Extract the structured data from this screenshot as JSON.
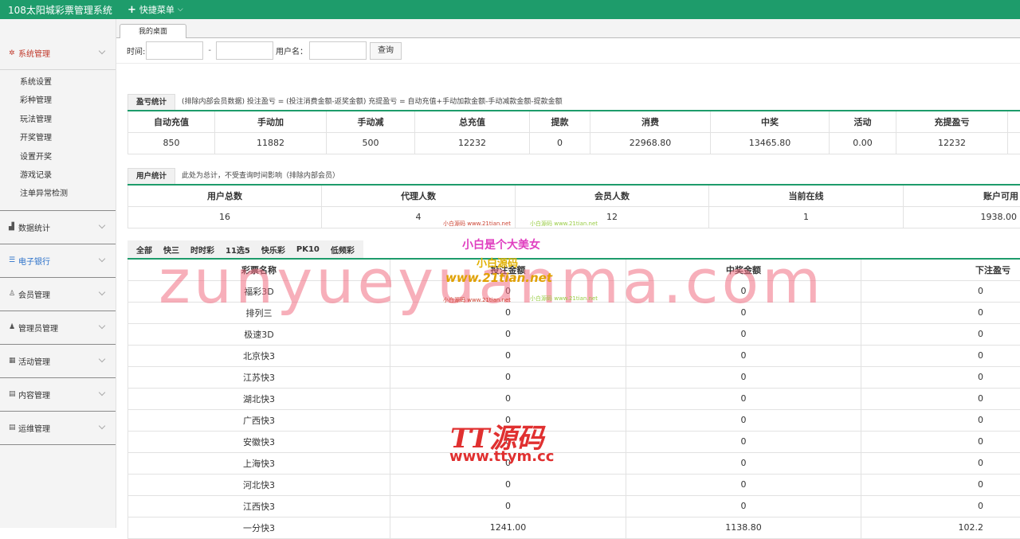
{
  "header": {
    "title": "108太阳城彩票管理系统",
    "quick_menu": "快捷菜单"
  },
  "sidebar": {
    "groups": [
      {
        "label": "系统管理",
        "icon": "gear-icon",
        "items": [
          "系统设置",
          "彩种管理",
          "玩法管理",
          "开奖管理",
          "设置开奖",
          "游戏记录",
          "注单异常检测"
        ]
      },
      {
        "label": "数据统计",
        "icon": "bar-chart-icon"
      },
      {
        "label": "电子银行",
        "icon": "list-icon"
      },
      {
        "label": "会员管理",
        "icon": "user-icon"
      },
      {
        "label": "管理员管理",
        "icon": "admin-icon"
      },
      {
        "label": "活动管理",
        "icon": "calendar-icon"
      },
      {
        "label": "内容管理",
        "icon": "content-icon"
      },
      {
        "label": "运维管理",
        "icon": "ops-icon"
      }
    ]
  },
  "tabs": {
    "desktop": "我的桌面"
  },
  "filter": {
    "time_label": "时间:",
    "dash": "-",
    "user_label": "用户名：",
    "query_button": "查询"
  },
  "profit": {
    "title": "盈亏统计",
    "note": "(排除内部会员数据)  投注盈亏 = (投注消费金额-返奖金额)    充提盈亏 = 自动充值+手动加款金额-手动减款金额-提款金额",
    "headers": [
      "自动充值",
      "手动加",
      "手动减",
      "总充值",
      "提款",
      "消费",
      "中奖",
      "活动",
      "充提盈亏"
    ],
    "values": [
      "850",
      "11882",
      "500",
      "12232",
      "0",
      "22968.80",
      "13465.80",
      "0.00",
      "12232"
    ]
  },
  "users": {
    "title": "用户统计",
    "note": "此处为总计，不受查询时间影响（排除内部会员）",
    "headers": [
      "用户总数",
      "代理人数",
      "会员人数",
      "当前在线",
      "账户可用"
    ],
    "values": [
      "16",
      "4",
      "12",
      "1",
      "1938.00"
    ]
  },
  "lottery_tabs": [
    "全部",
    "快三",
    "时时彩",
    "11选5",
    "快乐彩",
    "PK10",
    "低频彩"
  ],
  "lottery": {
    "headers": [
      "彩票名称",
      "投注金额",
      "中奖金额",
      "下注盈亏"
    ],
    "rows": [
      [
        "福彩3D",
        "0",
        "0",
        "0"
      ],
      [
        "排列三",
        "0",
        "0",
        "0"
      ],
      [
        "极速3D",
        "0",
        "0",
        "0"
      ],
      [
        "北京快3",
        "0",
        "0",
        "0"
      ],
      [
        "江苏快3",
        "0",
        "0",
        "0"
      ],
      [
        "湖北快3",
        "0",
        "0",
        "0"
      ],
      [
        "广西快3",
        "0",
        "0",
        "0"
      ],
      [
        "安徽快3",
        "0",
        "0",
        "0"
      ],
      [
        "上海快3",
        "0",
        "0",
        "0"
      ],
      [
        "河北快3",
        "0",
        "0",
        "0"
      ],
      [
        "江西快3",
        "0",
        "0",
        "0"
      ],
      [
        "一分快3",
        "1241.00",
        "1138.80",
        "102.2"
      ]
    ]
  },
  "watermarks": {
    "big": "zunyueyuanma.com",
    "cn1": "小白是个大美女",
    "cn2": "小白源码",
    "url": "www.21tian.net",
    "small_a": "小白源码 www.21tian.net",
    "small_b": "小白源码 www.21tian.net",
    "tt": "TT源码",
    "tt_url": "www.ttym.cc"
  }
}
